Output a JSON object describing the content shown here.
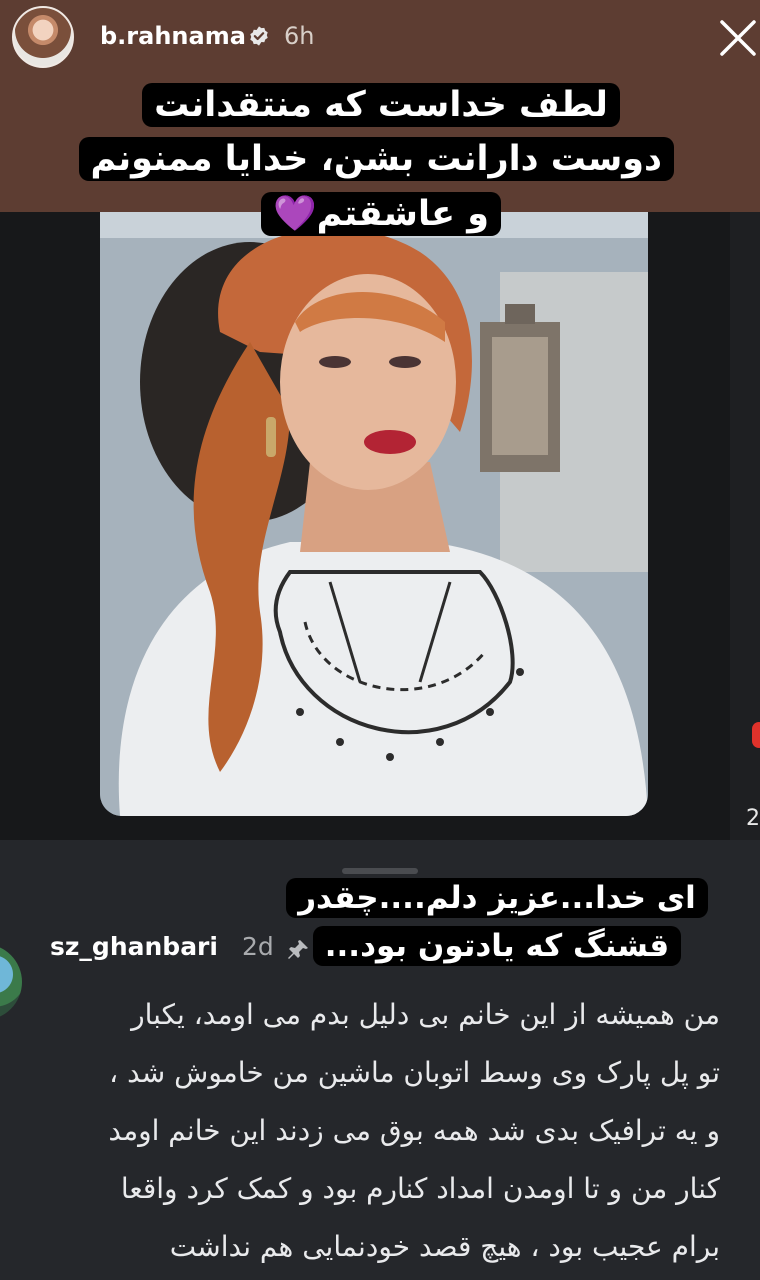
{
  "header": {
    "username": "b.rahnama",
    "time": "6h"
  },
  "caption_top": "لطف خداست که منتقدانت دوست دارانت بشن، خدایا ممنونم و عاشقتم💜",
  "caption_mid": "ای خدا...عزیز دلم....چقدر قشنگ که یادتون بود...",
  "side_number": "2",
  "comment": {
    "username": "sz_ghanbari",
    "time": "2d",
    "lines": [
      "من همیشه از این خانم بی دلیل بدم می اومد، یکبار",
      "تو پل پارک وی وسط اتوبان ماشین من خاموش شد ،",
      "و یه ترافیک بدی شد همه بوق می زدند این خانم اومد",
      "کنار من و تا اومدن امداد کنارم بود و کمک کرد واقعا",
      "برام عجیب بود ، هیچ قصد خودنمایی هم نداشت"
    ]
  },
  "colors": {
    "top_band": "#5d3d32",
    "card": "#17181a",
    "comment_bg": "#25272b",
    "verified_blue": "#3d9bf0",
    "notification_red": "#e0322b"
  },
  "icons": {
    "close": "close-icon",
    "verified": "verified-badge-icon",
    "pin": "pin-icon"
  }
}
